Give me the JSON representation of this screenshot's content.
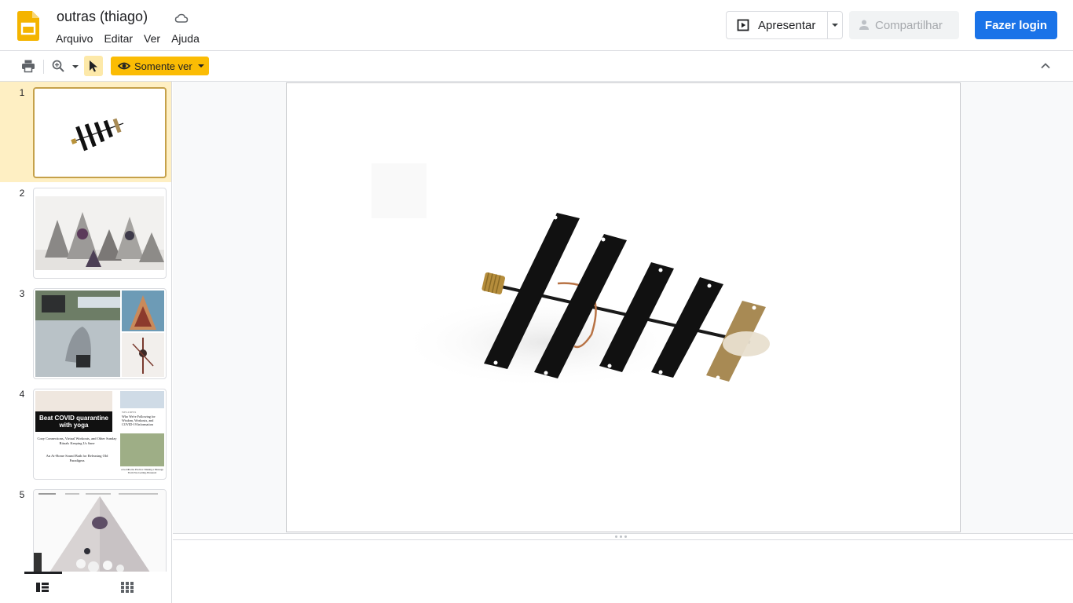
{
  "document": {
    "title": "outras (thiago)",
    "menu": [
      "Arquivo",
      "Editar",
      "Ver",
      "Ajuda"
    ]
  },
  "header": {
    "present_label": "Apresentar",
    "share_label": "Compartilhar",
    "login_label": "Fazer login"
  },
  "toolbar": {
    "view_mode_label": "Somente ver"
  },
  "filmstrip": {
    "slides": [
      {
        "number": "1",
        "content": "antenna-photo",
        "active": true
      },
      {
        "number": "2",
        "content": "orgonite-pyramids-photo"
      },
      {
        "number": "3",
        "content": "collage-photos"
      },
      {
        "number": "4",
        "content": "news-collage"
      },
      {
        "number": "5",
        "content": "pyramid-photo"
      }
    ],
    "thumb4": {
      "banner": "Beat COVID quarantine with yoga",
      "headline1": "Cozy Connections, Virtual Workouts, and Other Sunday Rituals Keeping Us Sane",
      "headline2": "An At-Home Sound Bath for Releasing Old Paradigms",
      "sidebar_kicker": "WELLNESS",
      "sidebar_headline": "Who We're Following for Wisdom, Workouts, and COVID-19 Information",
      "sidebar_caption": "A Goldilocks Practice: Making a Massage From Not-Getting-Pleasured"
    }
  },
  "colors": {
    "accent_blue": "#1a73e8",
    "view_mode_yellow": "#fbbc04",
    "active_slide_bg": "#feefc3",
    "slides_logo_yellow": "#f4b400"
  }
}
